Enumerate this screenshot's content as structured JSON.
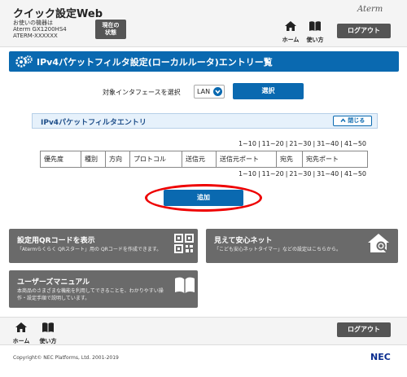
{
  "header": {
    "app_title": "クイック設定Web",
    "device_caption": "お使いの機器は",
    "device_model": "Aterm GX1200HS4",
    "device_name": "ATERM-XXXXXX",
    "status_line1": "現在の",
    "status_line2": "状態",
    "brand": "Aterm",
    "home_label": "ホーム",
    "help_label": "使い方",
    "logout_label": "ログアウト"
  },
  "page": {
    "title": "IPv4パケットフィルタ設定(ローカルルータ)エントリー覧"
  },
  "interface": {
    "label": "対象インタフェースを選択",
    "selected": "LAN",
    "select_button": "選択"
  },
  "entry_panel": {
    "title": "IPv4パケットフィルタエントリ",
    "close_label": "閉じる"
  },
  "pagination": [
    "1~10",
    "11~20",
    "21~30",
    "31~40",
    "41~50"
  ],
  "table": {
    "columns": [
      "優先度",
      "種別",
      "方向",
      "プロトコル",
      "送信元",
      "送信元ポート",
      "宛先",
      "宛先ポート"
    ]
  },
  "add_button": "追加",
  "tiles": {
    "qr": {
      "title": "設定用QRコードを表示",
      "desc": "「Atermらくらく QRスタート」用の QRコードを作成できます。"
    },
    "safety": {
      "title": "見えて安心ネット",
      "desc": "「こども安心ネットタイマー」などの設定はこちらから。"
    },
    "manual": {
      "title": "ユーザーズマニュアル",
      "desc_line1": "本商品のさまざまな機能を利用してできることを、わかりやすい操",
      "desc_line2": "作・設定手順で説明しています。"
    }
  },
  "footer": {
    "home_label": "ホーム",
    "help_label": "使い方",
    "logout_label": "ログアウト",
    "copyright": "Copyright© NEC Platforms, Ltd. 2001-2019",
    "logo": "NEC"
  },
  "colors": {
    "accent": "#0a69b0",
    "dark_button": "#555555",
    "tile": "#6a6a6a",
    "highlight": "#ee0000"
  }
}
